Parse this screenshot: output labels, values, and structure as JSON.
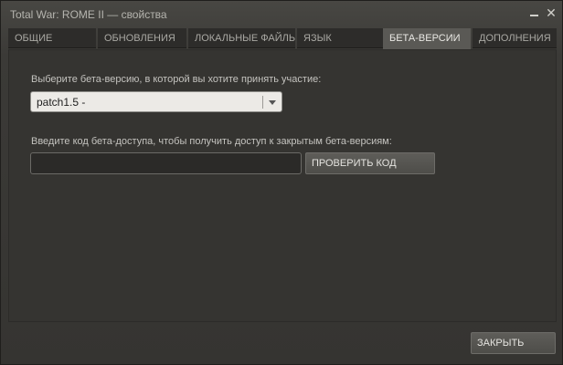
{
  "window": {
    "title": "Total War: ROME II — свойства"
  },
  "tabs": [
    {
      "label": "ОБЩИЕ"
    },
    {
      "label": "ОБНОВЛЕНИЯ"
    },
    {
      "label": "ЛОКАЛЬНЫЕ ФАЙЛЫ"
    },
    {
      "label": "ЯЗЫК"
    },
    {
      "label": "БЕТА-ВЕРСИИ"
    },
    {
      "label": "ДОПОЛНЕНИЯ"
    }
  ],
  "active_tab": "БЕТА-ВЕРСИИ",
  "beta": {
    "select_label": "Выберите бета-версию, в которой вы хотите принять участие:",
    "selected": "patch1.5 -",
    "code_label": "Введите код бета-доступа, чтобы получить доступ к закрытым бета-версиям:",
    "code_value": "",
    "check_button": "ПРОВЕРИТЬ КОД"
  },
  "footer": {
    "close_button": "ЗАКРЫТЬ"
  }
}
